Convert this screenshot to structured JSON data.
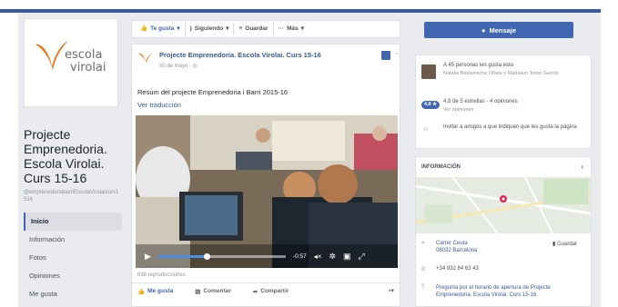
{
  "brand": {
    "logo_line1": "escola",
    "logo_line2": "virolai",
    "accent": "#e8771e",
    "fb_blue": "#4267b2"
  },
  "page": {
    "name": "Projecte Emprenedoria. Escola Virolai. Curs 15-16",
    "handle": "@emprenedoriabarriEscolaVirolaicurs1516"
  },
  "left_nav": [
    {
      "label": "Inicio",
      "active": true
    },
    {
      "label": "Información"
    },
    {
      "label": "Fotos"
    },
    {
      "label": "Opiniones"
    },
    {
      "label": "Me gusta"
    }
  ],
  "action_bar": {
    "like": "Te gusta",
    "following": "Siguiendo",
    "save": "Guardar",
    "more": "Más"
  },
  "post": {
    "author": "Projecte Emprenedoria. Escola Virolai. Curs 15-16",
    "date": "30 de mayo · ",
    "text": "Resum del projecte Emprenedoria i Barri 2015-16",
    "translate": "Ver traducción",
    "views": "638 reproducciones",
    "video": {
      "time": "-0:57",
      "progress": 0.38
    },
    "actions": {
      "like": "Me gusta",
      "comment": "Comentar",
      "share": "Compartir"
    }
  },
  "right": {
    "message_button": "Mensaje",
    "likes_text": "A 45 personas les gusta esto",
    "likes_names": "Natalia Bestarreche Oñate y Marlasun Tomé García",
    "rating_badge": "4,8 ★",
    "rating_text": "4,8 de 5 estrellas · 4 opiniones",
    "see_reviews": "Ver opiniones",
    "invite": "Invitar a amigos a que indiquen que les gusta la página",
    "info_header": "INFORMACIÓN",
    "address_line1": "Carrer Ceuta",
    "address_line2": "08032 Barcelona",
    "save_label": "Guardar",
    "phone": "+34 932 84 63 43",
    "hours_question": "Pregunta por el horario de apertura de Projecte Emprenedoria. Escola Virolai. Curs 15-16"
  },
  "icons": [
    "thumbs-up-icon",
    "rss-icon",
    "bookmark-icon",
    "more-icon",
    "messenger-icon",
    "globe-icon",
    "play-icon",
    "volume-icon",
    "settings-icon",
    "pip-icon",
    "fullscreen-icon",
    "comment-icon",
    "share-icon",
    "pin-icon",
    "phone-icon",
    "question-icon",
    "invite-icon"
  ]
}
